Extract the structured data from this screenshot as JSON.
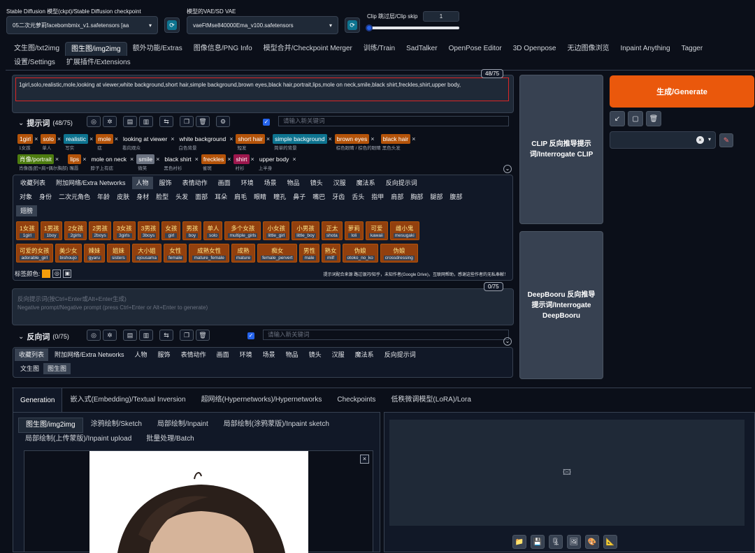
{
  "top": {
    "ckpt_label": "Stable Diffusion 模型(ckpt)/Stable Diffusion checkpoint",
    "ckpt_value": "05二次元萝莉facebombmix_v1.safetensors [aa",
    "vae_label": "模型的VAE/SD VAE",
    "vae_value": "vaeFtMse840000Ema_v100.safetensors",
    "clip_label": "Clip 跳过层/Clip skip",
    "clip_value": "1",
    "clip_fraction": 0.0
  },
  "main_tabs": [
    "文生图/txt2img",
    "图生图/img2img",
    "额外功能/Extras",
    "图像信息/PNG Info",
    "模型合并/Checkpoint Merger",
    "训练/Train",
    "SadTalker",
    "OpenPose Editor",
    "3D Openpose",
    "无边图像浏览",
    "Inpaint Anything",
    "Tagger"
  ],
  "main_tabs2": [
    "设置/Settings",
    "扩展插件/Extensions"
  ],
  "prompt": {
    "counter": "48/75",
    "text": "1girl,solo,realistic,mole,looking at viewer,white background,short hair,simple background,brown eyes,black hair,portrait,lips,mole on neck,smile,black shirt,freckles,shirt,upper body,",
    "section_title": "提示词",
    "section_count": "(48/75)",
    "search_placeholder": "请输入新关键词"
  },
  "tags_row1": [
    {
      "label": "1girl",
      "sub": "1女孩",
      "color": "#b45309"
    },
    {
      "label": "solo",
      "sub": "单人",
      "color": "#b45309"
    },
    {
      "label": "realistic",
      "sub": "写实",
      "color": "#0e7490"
    },
    {
      "label": "mole",
      "sub": "痣",
      "color": "#b45309"
    },
    {
      "label": "looking at viewer",
      "sub": "看向观众",
      "color": ""
    },
    {
      "label": "white background",
      "sub": "白色背景",
      "color": ""
    },
    {
      "label": "short hair",
      "sub": "短发",
      "color": "#b45309"
    },
    {
      "label": "simple background",
      "sub": "简单的背景",
      "color": "#0e7490"
    },
    {
      "label": "brown eyes",
      "sub": "棕色眼睛 / 棕色的眼睛",
      "color": "#b45309"
    },
    {
      "label": "black hair",
      "sub": "黑色头发",
      "color": "#b45309"
    }
  ],
  "tags_row2": [
    {
      "label": "肖像/portrait",
      "sub": "肖像画(脸+肩+偶尔胸部)",
      "color": "#4d7c0f"
    },
    {
      "label": "lips",
      "sub": "嘴唇",
      "color": "#b45309"
    },
    {
      "label": "mole on neck",
      "sub": "脖子上有痣",
      "color": ""
    },
    {
      "label": "smile",
      "sub": "微笑",
      "color": "#6b7280"
    },
    {
      "label": "black shirt",
      "sub": "黑色衬衫",
      "color": ""
    },
    {
      "label": "freckles",
      "sub": "雀斑",
      "color": "#b45309"
    },
    {
      "label": "shirt",
      "sub": "衬衫",
      "color": "#9d174d"
    },
    {
      "label": "upper body",
      "sub": "上半身",
      "color": ""
    }
  ],
  "cat_tabs": [
    "收藏列表",
    "附加网络/Extra Networks",
    "人物",
    "服饰",
    "表情动作",
    "画面",
    "环境",
    "场景",
    "物品",
    "镜头",
    "汉服",
    "魔法系",
    "反向提示词"
  ],
  "sub_cats": [
    "对象",
    "身份",
    "二次元角色",
    "年龄",
    "皮肤",
    "身材",
    "脸型",
    "头发",
    "面部",
    "耳朵",
    "肩毛",
    "眼睛",
    "瞳孔",
    "鼻子",
    "嘴巴",
    "牙齿",
    "舌头",
    "指甲",
    "肩部",
    "胸部",
    "腿部",
    "腹部"
  ],
  "sub_cats2": [
    "翅膀"
  ],
  "chips_row1": [
    {
      "a": "1女孩",
      "b": "1girl"
    },
    {
      "a": "1男孩",
      "b": "1boy"
    },
    {
      "a": "2女孩",
      "b": "2girls"
    },
    {
      "a": "2男孩",
      "b": "2boys"
    },
    {
      "a": "3女孩",
      "b": "3girls"
    },
    {
      "a": "3男孩",
      "b": "3boys"
    },
    {
      "a": "女孩",
      "b": "girl"
    },
    {
      "a": "男孩",
      "b": "boy"
    },
    {
      "a": "单人",
      "b": "solo"
    },
    {
      "a": "多个女孩",
      "b": "multiple_girls"
    },
    {
      "a": "小女孩",
      "b": "little_girl"
    },
    {
      "a": "小男孩",
      "b": "little_boy"
    },
    {
      "a": "正太",
      "b": "shota"
    },
    {
      "a": "萝莉",
      "b": "loli"
    },
    {
      "a": "可爱",
      "b": "kawaii"
    },
    {
      "a": "雌小鬼",
      "b": "mesugaki"
    }
  ],
  "chips_row2": [
    {
      "a": "可爱的女孩",
      "b": "adorable_girl"
    },
    {
      "a": "美少女",
      "b": "bishoujo"
    },
    {
      "a": "辣妹",
      "b": "gyaru"
    },
    {
      "a": "姐妹",
      "b": "sisters"
    },
    {
      "a": "大小姐",
      "b": "ojousama"
    },
    {
      "a": "女性",
      "b": "female"
    },
    {
      "a": "成熟女性",
      "b": "mature_female"
    },
    {
      "a": "成熟",
      "b": "mature"
    },
    {
      "a": "痴女",
      "b": "female_pervert"
    },
    {
      "a": "男性",
      "b": "male"
    },
    {
      "a": "熟女",
      "b": "milf"
    },
    {
      "a": "伪娘",
      "b": "otoko_no_ko"
    },
    {
      "a": "伪娘",
      "b": "crossdressing"
    }
  ],
  "tag_color_label": "标签颜色:",
  "tag_note": "提示词配合来源 路过银河/知乎，未知作者(Google Drive)，互联网帮助，感谢这些作者的无私奉献！",
  "neg": {
    "counter": "0/75",
    "placeholder1": "反向提示词(按Ctrl+Enter或Alt+Enter生成)",
    "placeholder2": "Negative prompt/Negative prompt (press Ctrl+Enter or Alt+Enter to generate)",
    "section_title": "反向词",
    "section_count": "(0/75)",
    "search_placeholder": "请输入新关键词"
  },
  "neg_tabs": [
    "收藏列表",
    "附加网络/Extra Networks",
    "人物",
    "服饰",
    "表情动作",
    "画面",
    "环境",
    "场景",
    "物品",
    "镜头",
    "汉服",
    "魔法系",
    "反向提示词"
  ],
  "neg_sub": [
    "文生图",
    "图生图"
  ],
  "right": {
    "generate": "生成/Generate",
    "clip_btn": "CLIP 反向推导提示词/Interrogate CLIP",
    "deepbooru_btn": "DeepBooru 反向推导提示词/Interrogate DeepBooru"
  },
  "bottom_tabs": [
    "Generation",
    "嵌入式(Embedding)/Textual Inversion",
    "超网络(Hypernetworks)/Hypernetworks",
    "Checkpoints",
    "低秩微调模型(LoRA)/Lora"
  ],
  "img_tabs": [
    "图生图/img2img",
    "涂鸦绘制/Sketch",
    "局部绘制/Inpaint",
    "局部绘制(涂鸦蒙版)/Inpaint sketch"
  ],
  "img_tabs2": [
    "局部绘制(上传蒙版)/Inpaint upload",
    "批量处理/Batch"
  ]
}
